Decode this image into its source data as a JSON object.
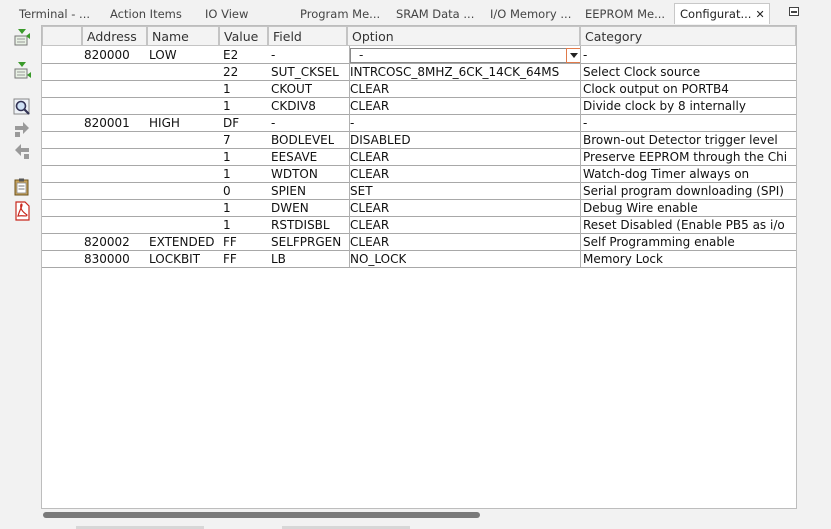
{
  "tabs": [
    {
      "label": "Terminal - ..."
    },
    {
      "label": "Action Items"
    },
    {
      "label": "IO View"
    },
    {
      "label": "Program Me..."
    },
    {
      "label": "SRAM Data ..."
    },
    {
      "label": "I/O Memory ..."
    },
    {
      "label": "EEPROM Me..."
    },
    {
      "label": "Configurat..."
    }
  ],
  "active_tab_close": "✕",
  "columns": {
    "address": "Address",
    "name": "Name",
    "value": "Value",
    "field": "Field",
    "option": "Option",
    "category": "Category"
  },
  "rows": [
    {
      "address": "820000",
      "name": "LOW",
      "value": "E2",
      "field": "-",
      "option": "-",
      "category": "-"
    },
    {
      "address": "",
      "name": "",
      "value": "22",
      "field": "SUT_CKSEL",
      "option": "INTRCOSC_8MHZ_6CK_14CK_64MS",
      "category": "Select Clock source"
    },
    {
      "address": "",
      "name": "",
      "value": "1",
      "field": "CKOUT",
      "option": "CLEAR",
      "category": "Clock output on PORTB4"
    },
    {
      "address": "",
      "name": "",
      "value": "1",
      "field": "CKDIV8",
      "option": "CLEAR",
      "category": "Divide clock by 8 internally"
    },
    {
      "address": "820001",
      "name": "HIGH",
      "value": "DF",
      "field": "-",
      "option": "-",
      "category": "-"
    },
    {
      "address": "",
      "name": "",
      "value": "7",
      "field": "BODLEVEL",
      "option": "DISABLED",
      "category": "Brown-out Detector trigger level"
    },
    {
      "address": "",
      "name": "",
      "value": "1",
      "field": "EESAVE",
      "option": "CLEAR",
      "category": "Preserve EEPROM through the Chi"
    },
    {
      "address": "",
      "name": "",
      "value": "1",
      "field": "WDTON",
      "option": "CLEAR",
      "category": "Watch-dog Timer always on"
    },
    {
      "address": "",
      "name": "",
      "value": "0",
      "field": "SPIEN",
      "option": "SET",
      "category": "Serial program downloading (SPI)"
    },
    {
      "address": "",
      "name": "",
      "value": "1",
      "field": "DWEN",
      "option": "CLEAR",
      "category": "Debug Wire enable"
    },
    {
      "address": "",
      "name": "",
      "value": "1",
      "field": "RSTDISBL",
      "option": "CLEAR",
      "category": "Reset Disabled (Enable PB5 as i/o"
    },
    {
      "address": "820002",
      "name": "EXTENDED",
      "value": "FF",
      "field": "SELFPRGEN",
      "option": "CLEAR",
      "category": "Self Programming enable"
    },
    {
      "address": "830000",
      "name": "LOCKBIT",
      "value": "FF",
      "field": "LB",
      "option": "NO_LOCK",
      "category": "Memory Lock"
    }
  ],
  "toolbar_icons": [
    "import-icon",
    "export-icon",
    "search-icon",
    "move-down-icon",
    "move-up-icon",
    "clipboard-icon",
    "pdf-icon"
  ],
  "colors": {
    "accent_combo": "#e07a4a",
    "icon_green": "#3a9a2a",
    "pdf_red": "#c8281e"
  }
}
